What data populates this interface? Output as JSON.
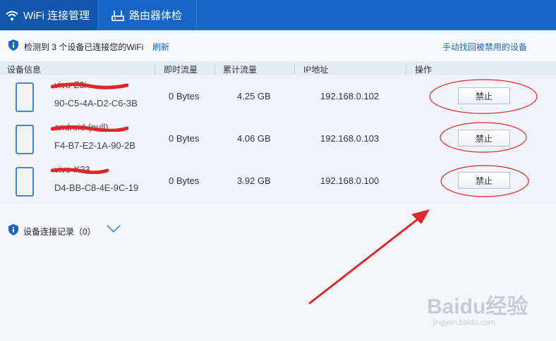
{
  "tabs": [
    {
      "label": "WiFi 连接管理",
      "icon": "wifi-icon",
      "active": true
    },
    {
      "label": "路由器体检",
      "icon": "router-icon",
      "active": false
    }
  ],
  "info": {
    "icon": "shield-icon",
    "text": "检测到 3 个设备已连接您的WiFi",
    "refresh": "刷新",
    "recover_link": "手动找回被禁用的设备"
  },
  "table": {
    "columns": [
      "设备信息",
      "即时流量",
      "累计流量",
      "IP地址",
      "操作"
    ],
    "rows": [
      {
        "name": "vivo-Z3i",
        "mac": "90-C5-4A-D2-C6-3B",
        "instant": "0 Bytes",
        "total": "4.25 GB",
        "ip": "192.168.0.102",
        "action": "禁止"
      },
      {
        "name": "android-(null)",
        "mac": "F4-B7-E2-1A-90-2B",
        "instant": "0 Bytes",
        "total": "4.06 GB",
        "ip": "192.168.0.103",
        "action": "禁止"
      },
      {
        "name": "vivo-X23",
        "mac": "D4-BB-C8-4E-9C-19",
        "instant": "0 Bytes",
        "total": "3.92 GB",
        "ip": "192.168.0.100",
        "action": "禁止"
      }
    ]
  },
  "record": {
    "label": "设备连接记录（0）",
    "icon": "chevron-down-icon"
  },
  "watermark": {
    "brand": "Baidu经验",
    "url": "jingyan.baidu.com"
  },
  "colors": {
    "topbar": "#1766c6",
    "active_tab": "#1257ad",
    "link": "#1766c6",
    "annotation": "#e0262a"
  }
}
